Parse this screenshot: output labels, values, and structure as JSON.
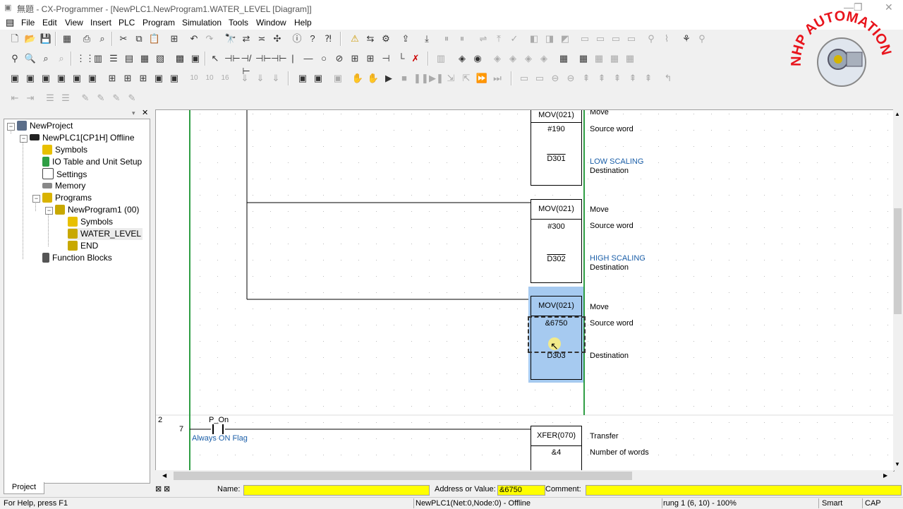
{
  "window": {
    "title": "無題 - CX-Programmer - [NewPLC1.NewProgram1.WATER_LEVEL [Diagram]]"
  },
  "menu": [
    "File",
    "Edit",
    "View",
    "Insert",
    "PLC",
    "Program",
    "Simulation",
    "Tools",
    "Window",
    "Help"
  ],
  "project_tree": {
    "root": "NewProject",
    "plc": "NewPLC1[CP1H] Offline",
    "symbols": "Symbols",
    "io_table": "IO Table and Unit Setup",
    "settings": "Settings",
    "memory": "Memory",
    "programs": "Programs",
    "program1": "NewProgram1 (00)",
    "prog_symbols": "Symbols",
    "section": "WATER_LEVEL",
    "end": "END",
    "function_blocks": "Function Blocks"
  },
  "project_tab": "Project",
  "diagram": {
    "mov1": {
      "instr": "MOV(021)",
      "op1": "#190",
      "op2": "D301",
      "comment": "Move",
      "op1_comment": "Source word",
      "op2_label": "LOW SCALING",
      "op2_comment": "Destination"
    },
    "mov2": {
      "instr": "MOV(021)",
      "op1": "#300",
      "op2": "D302",
      "comment": "Move",
      "op1_comment": "Source word",
      "op2_label": "HIGH SCALING",
      "op2_comment": "Destination"
    },
    "mov3": {
      "instr": "MOV(021)",
      "op1": "&6750",
      "op2": "D303",
      "comment": "Move",
      "op1_comment": "Source word",
      "op2_comment": "Destination"
    },
    "rung2": {
      "rung_no": "2",
      "step": "7",
      "contact": "P_On",
      "contact_comment": "Always ON Flag",
      "instr": "XFER(070)",
      "op1": "&4",
      "comment": "Transfer",
      "op1_comment": "Number of words"
    }
  },
  "fields": {
    "name_label": "Name:",
    "name_value": "",
    "addr_label": "Address or Value:",
    "addr_value": "&6750",
    "comment_label": "Comment:",
    "comment_value": ""
  },
  "status": {
    "help": "For Help, press F1",
    "plc": "NewPLC1(Net:0,Node:0) - Offline",
    "rung": "rung 1 (6, 10)  - 100%",
    "mode": "Smart",
    "caps": "CAP"
  },
  "logo": {
    "text": "NHP AUTOMATION"
  },
  "colors": {
    "selection": "#a6caf0",
    "field": "#ffff00",
    "rail": "#2f9e44",
    "comment_blue": "#1a5ea8"
  }
}
